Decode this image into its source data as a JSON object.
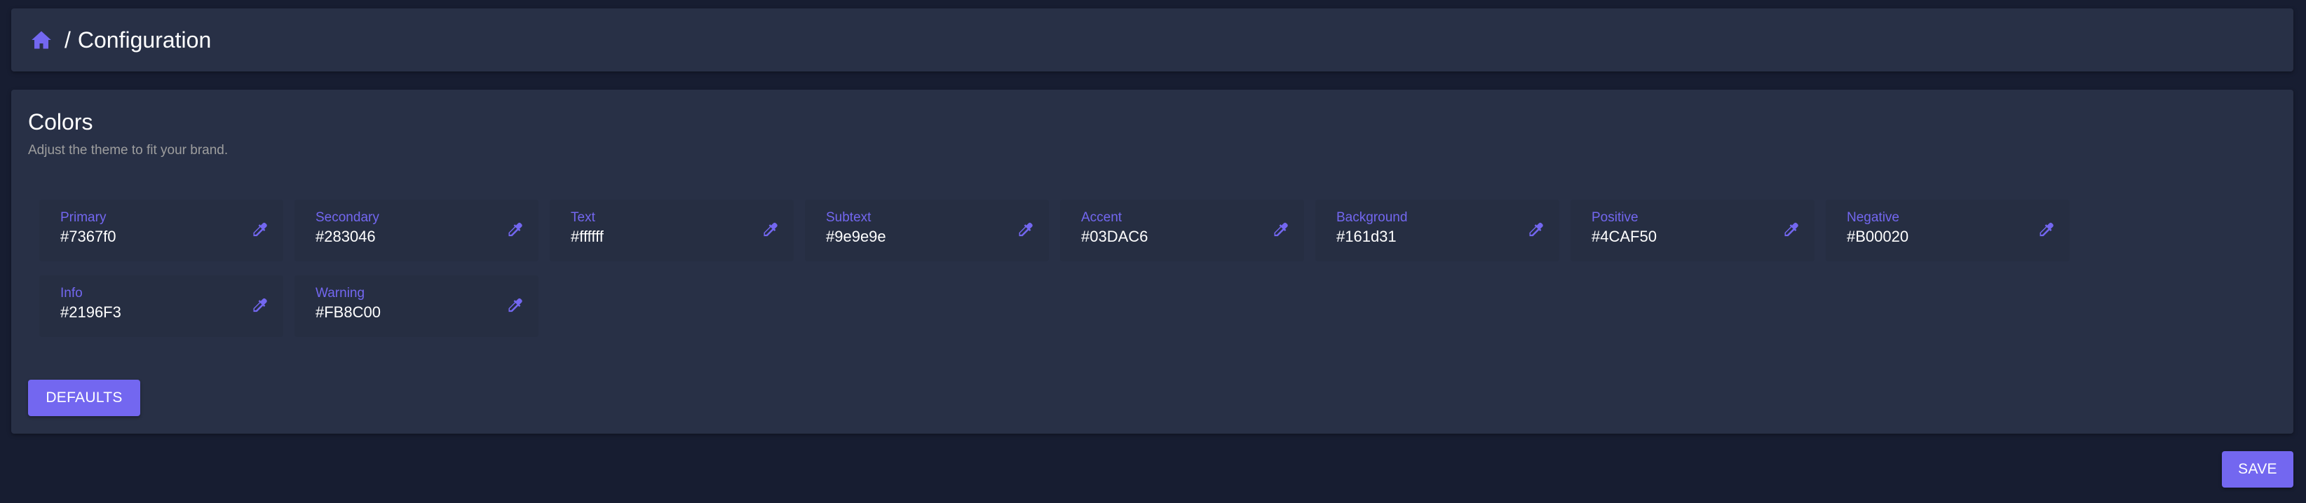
{
  "breadcrumb": {
    "home_icon": "home-icon",
    "separator": "/",
    "current": "Configuration"
  },
  "colors_section": {
    "title": "Colors",
    "subtitle": "Adjust the theme to fit your brand.",
    "picker_icon": "eyedropper-icon",
    "items": [
      {
        "label": "Primary",
        "value": "#7367f0"
      },
      {
        "label": "Secondary",
        "value": "#283046"
      },
      {
        "label": "Text",
        "value": "#ffffff"
      },
      {
        "label": "Subtext",
        "value": "#9e9e9e"
      },
      {
        "label": "Accent",
        "value": "#03DAC6"
      },
      {
        "label": "Background",
        "value": "#161d31"
      },
      {
        "label": "Positive",
        "value": "#4CAF50"
      },
      {
        "label": "Negative",
        "value": "#B00020"
      },
      {
        "label": "Info",
        "value": "#2196F3"
      },
      {
        "label": "Warning",
        "value": "#FB8C00"
      }
    ],
    "defaults_label": "DEFAULTS"
  },
  "save_label": "SAVE",
  "theme": {
    "accent": "#7367f0",
    "card": "#283046",
    "page_background": "#171d31",
    "subtext": "#9e9e9e"
  }
}
